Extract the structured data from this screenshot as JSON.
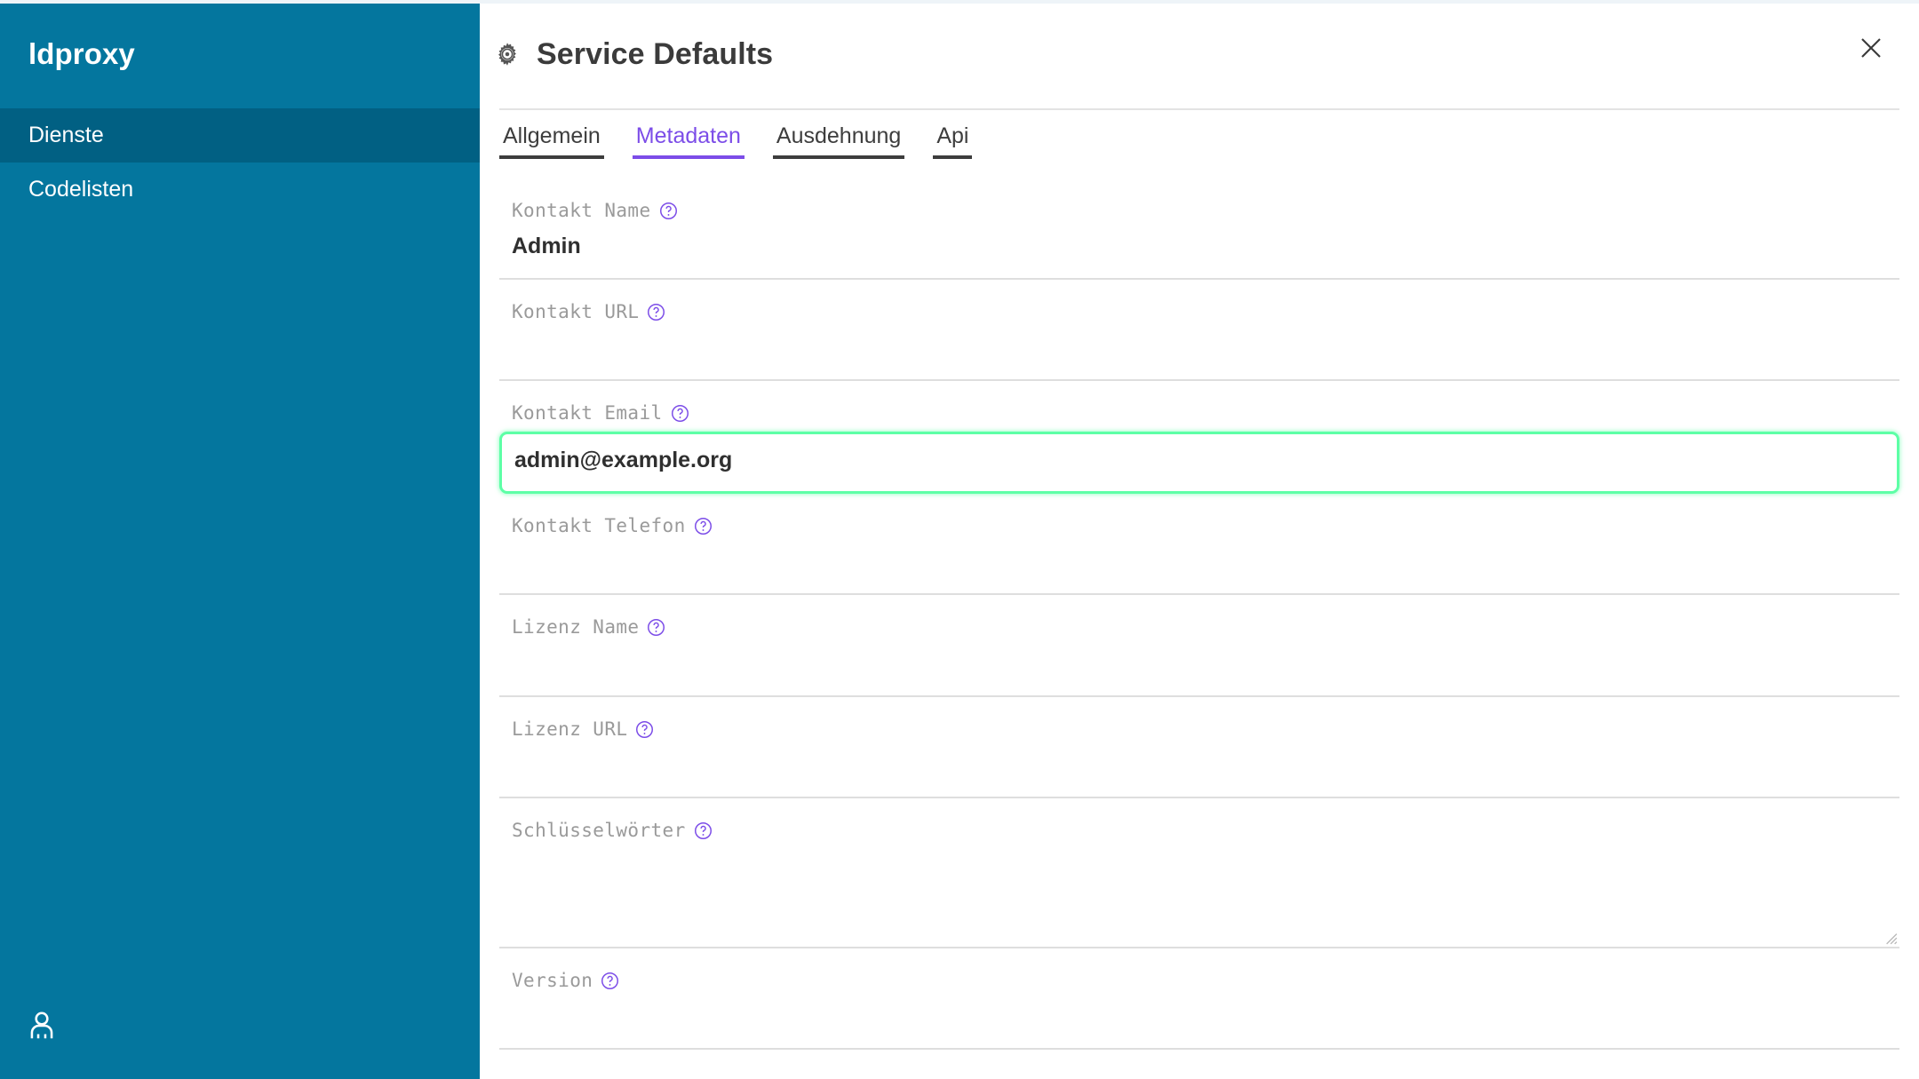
{
  "app": {
    "brand": "ldproxy",
    "sidebar_bg": "#04769e",
    "sidebar_active_bg": "#016083",
    "accent_purple": "#7c4de8",
    "focus_green": "#5dffa6"
  },
  "sidebar": {
    "items": [
      {
        "label": "Dienste",
        "active": true
      },
      {
        "label": "Codelisten",
        "active": false
      }
    ],
    "user_icon": "user-icon"
  },
  "header": {
    "icon": "gear-icon",
    "title": "Service Defaults",
    "close_icon": "close-icon"
  },
  "tabs": [
    {
      "label": "Allgemein",
      "active": false
    },
    {
      "label": "Metadaten",
      "active": true
    },
    {
      "label": "Ausdehnung",
      "active": false
    },
    {
      "label": "Api",
      "active": false
    }
  ],
  "form": {
    "help_icon": "help-circle-icon",
    "fields": [
      {
        "label": "Kontakt Name",
        "value": "Admin",
        "type": "text",
        "focused": false
      },
      {
        "label": "Kontakt URL",
        "value": "",
        "type": "text",
        "focused": false
      },
      {
        "label": "Kontakt Email",
        "value": "admin@example.org",
        "type": "text",
        "focused": true
      },
      {
        "label": "Kontakt Telefon",
        "value": "",
        "type": "text",
        "focused": false
      },
      {
        "label": "Lizenz Name",
        "value": "",
        "type": "text",
        "focused": false
      },
      {
        "label": "Lizenz URL",
        "value": "",
        "type": "text",
        "focused": false
      },
      {
        "label": "Schlüsselwörter",
        "value": "",
        "type": "textarea",
        "focused": false
      },
      {
        "label": "Version",
        "value": "",
        "type": "text",
        "focused": false
      }
    ]
  }
}
